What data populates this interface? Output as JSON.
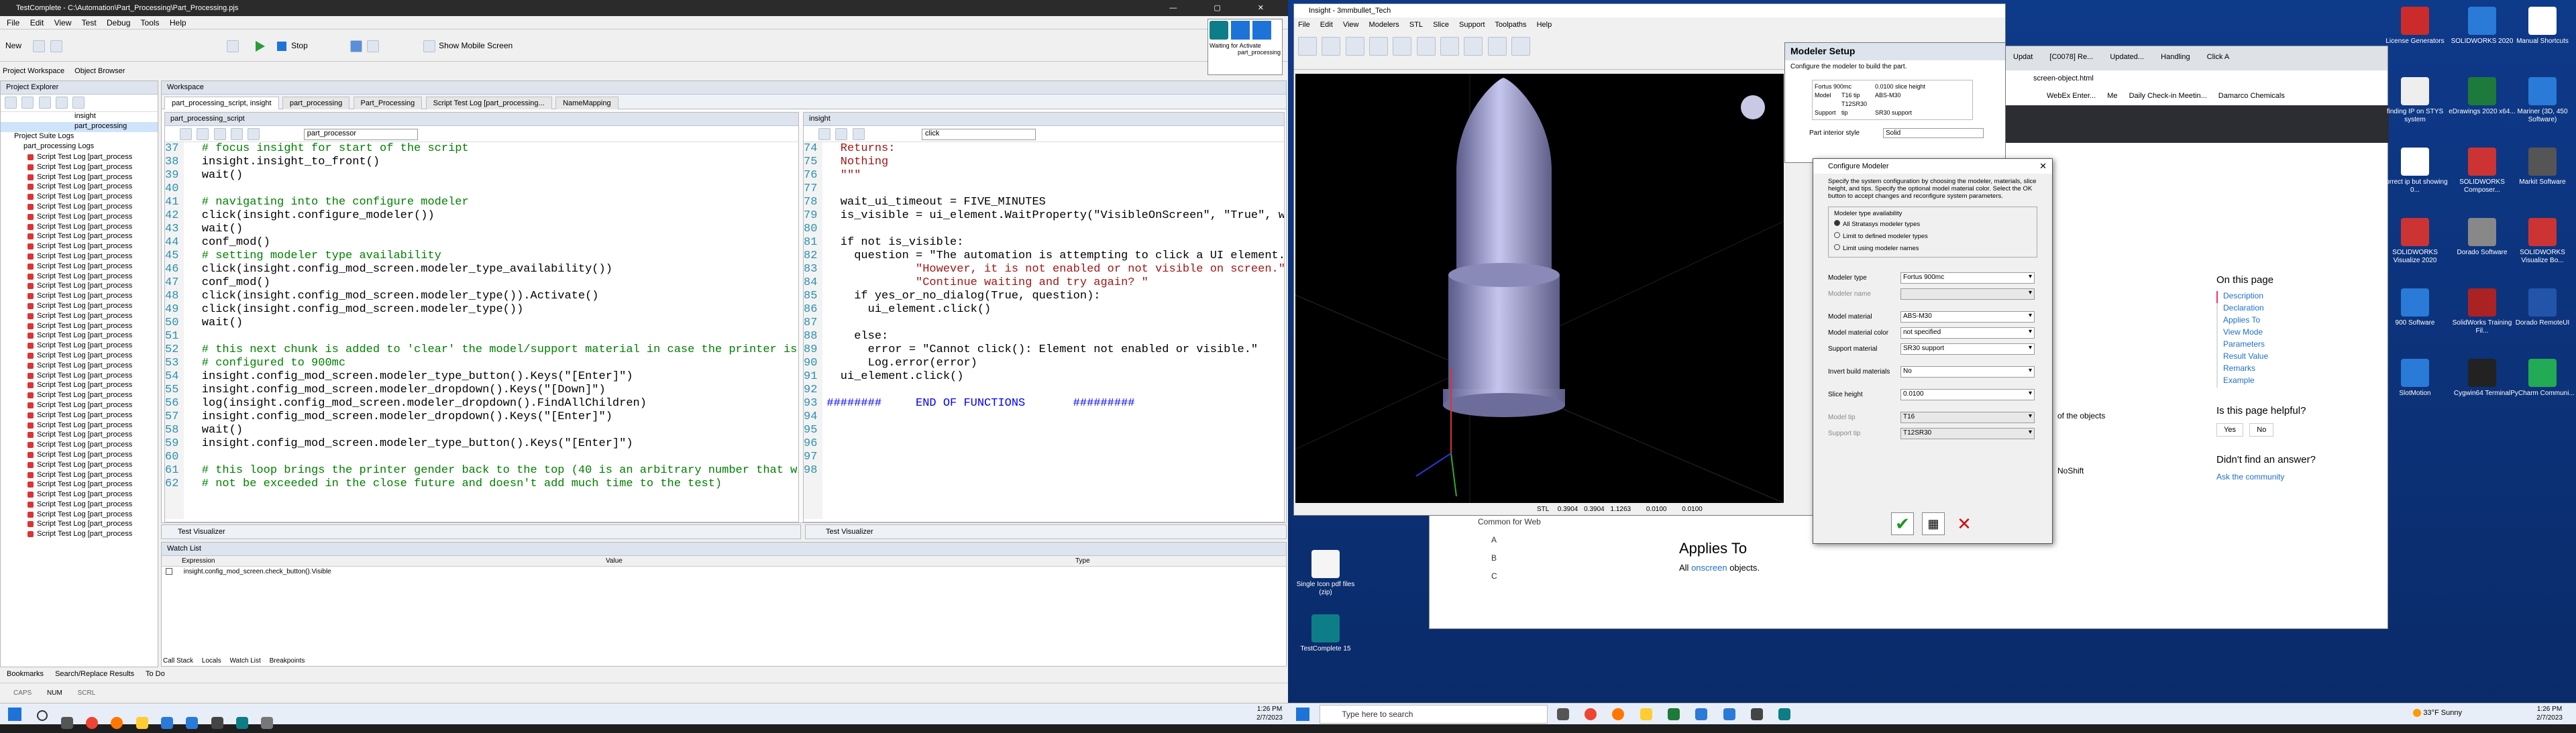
{
  "testcomplete": {
    "title": "TestComplete - C:\\Automation\\Part_Processing\\Part_Processing.pjs",
    "menu": [
      "File",
      "Edit",
      "View",
      "Test",
      "Debug",
      "Tools",
      "Help"
    ],
    "toolbar": {
      "new": "New",
      "stop": "Stop",
      "mobile": "Show Mobile Screen"
    },
    "left_tabs": [
      "Project Workspace",
      "Object Browser"
    ],
    "explorer_title": "Project Explorer",
    "workspace_title": "Workspace",
    "tree": {
      "suite": "Project Suite Logs",
      "insight": "insight",
      "part": "part_processing",
      "logs_root": "part_processing Logs",
      "logs": [
        "Script Test Log [part_process",
        "Script Test Log [part_process",
        "Script Test Log [part_process",
        "Script Test Log [part_process",
        "Script Test Log [part_process",
        "Script Test Log [part_process",
        "Script Test Log [part_process",
        "Script Test Log [part_process",
        "Script Test Log [part_process",
        "Script Test Log [part_process",
        "Script Test Log [part_process",
        "Script Test Log [part_process",
        "Script Test Log [part_process",
        "Script Test Log [part_process",
        "Script Test Log [part_process",
        "Script Test Log [part_process",
        "Script Test Log [part_process",
        "Script Test Log [part_process",
        "Script Test Log [part_process",
        "Script Test Log [part_process",
        "Script Test Log [part_process",
        "Script Test Log [part_process",
        "Script Test Log [part_process",
        "Script Test Log [part_process",
        "Script Test Log [part_process",
        "Script Test Log [part_process",
        "Script Test Log [part_process",
        "Script Test Log [part_process",
        "Script Test Log [part_process",
        "Script Test Log [part_process",
        "Script Test Log [part_process",
        "Script Test Log [part_process",
        "Script Test Log [part_process",
        "Script Test Log [part_process",
        "Script Test Log [part_process",
        "Script Test Log [part_process",
        "Script Test Log [part_process",
        "Script Test Log [part_process",
        "Script Test Log [part_process"
      ]
    },
    "doc_tabs": [
      "part_processing_script, insight",
      "part_processing",
      "Part_Processing",
      "Script Test Log [part_processing...",
      "NameMapping"
    ],
    "left_editor": {
      "title": "part_processing_script",
      "combo": "part_processor",
      "lines": [
        {
          "n": "37",
          "t": "  # focus insight for start of the script",
          "c": "c"
        },
        {
          "n": "38",
          "t": "  insight.insight_to_front()",
          "c": ""
        },
        {
          "n": "39",
          "t": "  wait()",
          "c": ""
        },
        {
          "n": "40",
          "t": "",
          "c": ""
        },
        {
          "n": "41",
          "t": "  # navigating into the configure modeler",
          "c": "c"
        },
        {
          "n": "42",
          "t": "  click(insight.configure_modeler())",
          "c": ""
        },
        {
          "n": "43",
          "t": "  wait()",
          "c": ""
        },
        {
          "n": "44",
          "t": "  conf_mod()",
          "c": ""
        },
        {
          "n": "45",
          "t": "  # setting modeler type availability",
          "c": "c"
        },
        {
          "n": "46",
          "t": "  click(insight.config_mod_screen.modeler_type_availability())",
          "c": ""
        },
        {
          "n": "47",
          "t": "  conf_mod()",
          "c": ""
        },
        {
          "n": "48",
          "t": "  click(insight.config_mod_screen.modeler_type()).Activate()",
          "c": ""
        },
        {
          "n": "49",
          "t": "  click(insight.config_mod_screen.modeler_type())",
          "c": ""
        },
        {
          "n": "50",
          "t": "  wait()",
          "c": ""
        },
        {
          "n": "51",
          "t": "",
          "c": ""
        },
        {
          "n": "52",
          "t": "  # this next chunk is added to 'clear' the model/support material in case the printer is",
          "c": "c"
        },
        {
          "n": "53",
          "t": "  # configured to 900mc",
          "c": "c"
        },
        {
          "n": "54",
          "t": "  insight.config_mod_screen.modeler_type_button().Keys(\"[Enter]\")",
          "c": ""
        },
        {
          "n": "55",
          "t": "  insight.config_mod_screen.modeler_dropdown().Keys(\"[Down]\")",
          "c": ""
        },
        {
          "n": "56",
          "t": "  log(insight.config_mod_screen.modeler_dropdown().FindAllChildren)",
          "c": ""
        },
        {
          "n": "57",
          "t": "  insight.config_mod_screen.modeler_dropdown().Keys(\"[Enter]\")",
          "c": ""
        },
        {
          "n": "58",
          "t": "  wait()",
          "c": ""
        },
        {
          "n": "59",
          "t": "  insight.config_mod_screen.modeler_type_button().Keys(\"[Enter]\")",
          "c": ""
        },
        {
          "n": "60",
          "t": "",
          "c": ""
        },
        {
          "n": "61",
          "t": "  # this loop brings the printer gender back to the top (40 is an arbitrary number that will prob",
          "c": "c"
        },
        {
          "n": "62",
          "t": "  # not be exceeded in the close future and doesn't add much time to the test)",
          "c": "c"
        }
      ]
    },
    "right_editor": {
      "title": "insight",
      "combo": "click",
      "lines": [
        {
          "n": "74",
          "t": "  Returns:",
          "c": "s"
        },
        {
          "n": "75",
          "t": "  Nothing",
          "c": "s"
        },
        {
          "n": "76",
          "t": "  \"\"\"",
          "c": "s"
        },
        {
          "n": "77",
          "t": "",
          "c": ""
        },
        {
          "n": "78",
          "t": "  wait_ui_timeout = FIVE_MINUTES",
          "c": ""
        },
        {
          "n": "79",
          "t": "  is_visible = ui_element.WaitProperty(\"VisibleOnScreen\", \"True\", wait",
          "c": ""
        },
        {
          "n": "80",
          "t": "",
          "c": ""
        },
        {
          "n": "81",
          "t": "  if not is_visible:",
          "c": ""
        },
        {
          "n": "82",
          "t": "    question = \"The automation is attempting to click a UI element. \"",
          "c": ""
        },
        {
          "n": "83",
          "t": "             \"However, it is not enabled or not visible on screen.\" \\",
          "c": "s"
        },
        {
          "n": "84",
          "t": "             \"Continue waiting and try again? \"",
          "c": "s"
        },
        {
          "n": "85",
          "t": "    if yes_or_no_dialog(True, question):",
          "c": ""
        },
        {
          "n": "86",
          "t": "      ui_element.click()",
          "c": ""
        },
        {
          "n": "87",
          "t": "",
          "c": ""
        },
        {
          "n": "88",
          "t": "    else:",
          "c": ""
        },
        {
          "n": "89",
          "t": "      error = \"Cannot click(): Element not enabled or visible.\"",
          "c": ""
        },
        {
          "n": "90",
          "t": "      Log.error(error)",
          "c": ""
        },
        {
          "n": "91",
          "t": "  ui_element.click()",
          "c": ""
        },
        {
          "n": "92",
          "t": "",
          "c": ""
        },
        {
          "n": "93",
          "t": "########     END OF FUNCTIONS       #########",
          "c": "k"
        },
        {
          "n": "94",
          "t": "",
          "c": ""
        },
        {
          "n": "95",
          "t": "",
          "c": ""
        },
        {
          "n": "96",
          "t": "",
          "c": ""
        },
        {
          "n": "97",
          "t": "",
          "c": ""
        },
        {
          "n": "98",
          "t": "",
          "c": ""
        }
      ]
    },
    "test_visualizer": "Test Visualizer",
    "watch": {
      "title": "Watch List",
      "cols": [
        "Expression",
        "Value",
        "Type"
      ],
      "row": "insight.config_mod_screen.check_button().Visible"
    },
    "bottom_tabs": [
      "Call Stack",
      "Locals",
      "Watch List",
      "Breakpoints"
    ],
    "foot_tabs": [
      "Bookmarks",
      "Search/Replace Results",
      "To Do"
    ],
    "status": [
      "CAPS",
      "NUM",
      "SCRL"
    ],
    "waiting": [
      "Waiting for Activate",
      "part_processing"
    ]
  },
  "insight": {
    "title": "Insight - 3mmbullet_Tech",
    "menu": [
      "File",
      "Edit",
      "View",
      "Modelers",
      "STL",
      "Slice",
      "Support",
      "Toolpaths",
      "Help"
    ],
    "status": {
      "type": "STL",
      "x": "0.3904",
      "y": "0.3904",
      "z": "1.1263",
      "z2": "0.0100",
      "d2": "0.0100",
      "fields": [
        "0.0000",
        "0.0000",
        "0.0100"
      ]
    }
  },
  "modeler_setup": {
    "title": "Modeler Setup",
    "desc": "Configure the modeler to build the part.",
    "info": [
      [
        "Fortus 900mc",
        "0.0100 slice height"
      ],
      [
        "Model",
        "T16 tip",
        "ABS-M30"
      ],
      [
        "Support",
        "T12SR30 tip",
        "SR30 support"
      ]
    ],
    "interior_label": "Part interior style",
    "interior": "Solid"
  },
  "configure_modeler": {
    "title": "Configure Modeler",
    "desc": "Specify the system configuration by choosing the modeler, materials, slice height, and tips. Specify the optional model material color. Select the OK button to accept changes and reconfigure system parameters.",
    "group": "Modeler type availability",
    "radios": [
      "All Stratasys modeler types",
      "Limit to defined modeler types",
      "Limit using modeler names"
    ],
    "fields": [
      {
        "label": "Modeler type",
        "value": "Fortus 900mc"
      },
      {
        "label": "Modeler name",
        "value": ""
      },
      {
        "label": "Model material",
        "value": "ABS-M30"
      },
      {
        "label": "Model material color",
        "value": "not specified"
      },
      {
        "label": "Support material",
        "value": "SR30 support"
      },
      {
        "label": "Invert build materials",
        "value": "No"
      },
      {
        "label": "Slice height",
        "value": "0.0100"
      },
      {
        "label": "Model tip",
        "value": "T16"
      },
      {
        "label": "Support tip",
        "value": "T12SR30"
      }
    ]
  },
  "browser": {
    "tabs": [
      "Updat",
      "[C0078] Re...",
      "Updated...",
      "Handling",
      "Click A"
    ],
    "address": "screen-object.html",
    "bookmarks": [
      "WebEx Enter...",
      "Me",
      "Daily Check-in Meetin...",
      "Damarco Chemicals"
    ],
    "on_this_page": "On this page",
    "toc": [
      "Description",
      "Declaration",
      "Applies To",
      "View Mode",
      "Parameters",
      "Result Value",
      "Remarks",
      "Example"
    ],
    "helpful": "Is this page helpful?",
    "yes": "Yes",
    "no": "No",
    "question": "Didn't find an answer?",
    "community": "Ask the community",
    "applies_to": "Applies To",
    "all_objects": "All",
    "onscreen": "onscreen",
    "objects": "objects.",
    "side_items": [
      "Common for Web",
      "A",
      "B",
      "C"
    ],
    "of_objects": "of the objects",
    "noshift": "NoShift"
  },
  "taskbar": {
    "search": "Type here to search",
    "weather": "33°F Sunny",
    "time": "1:26 PM",
    "date": "2/7/2023"
  },
  "desktop": {
    "icons": [
      "License Generators",
      "SOLIDWORKS 2020",
      "Manual Shortcuts",
      "finding IP on STYS system",
      "eDrawings 2020 x64...",
      "Mariner (3D, 450 Software)",
      "correct ip but showing 0...",
      "SOLIDWORKS Composer...",
      "Markit Software",
      "SOLIDWORKS Visualize 2020",
      "Dorado Software",
      "SOLIDWORKS Visualize Bo...",
      "900 Software",
      "SolidWorks Training Fil...",
      "Dorado RemoteUI",
      "SlotMotion",
      "Cygwin64 Terminal",
      "PyCharm Communi..."
    ],
    "mid_icons": [
      "Single Icon pdf files (zip)",
      "TestComplete 15"
    ]
  },
  "colors": {
    "accent": "#1e6fcc",
    "desktop": "#0a3a8a",
    "taskbar": "#e8eef7"
  }
}
